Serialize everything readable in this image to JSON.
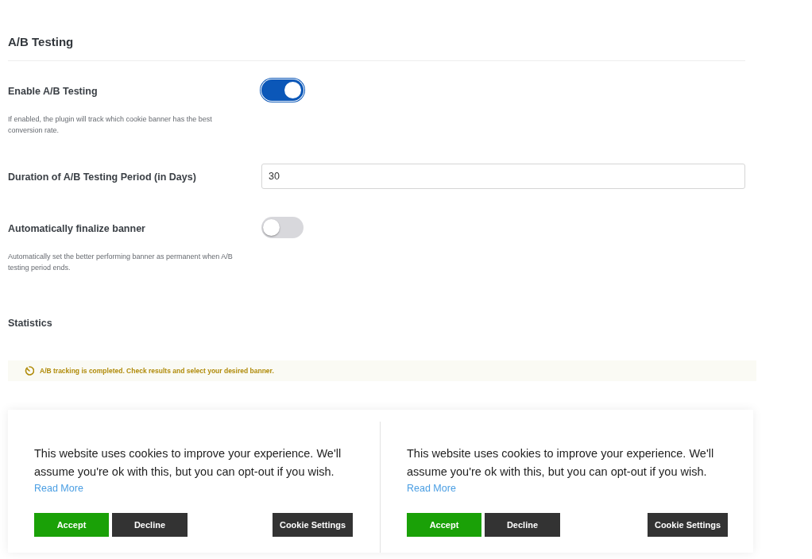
{
  "section": {
    "title": "A/B Testing"
  },
  "settings": [
    {
      "kind": "toggle",
      "label": "Enable A/B Testing",
      "on": true,
      "description": "If enabled, the plugin will track which cookie banner has the best conversion rate."
    },
    {
      "kind": "number",
      "label": "Duration of A/B Testing Period (in Days)",
      "value": "30"
    },
    {
      "kind": "toggle",
      "label": "Automatically finalize banner",
      "on": false,
      "description": "Automatically set the better performing banner as permanent when A/B testing period ends."
    }
  ],
  "statistics": {
    "title": "Statistics",
    "notice": "A/B tracking is completed. Check results and select your desired banner."
  },
  "banners": [
    {
      "message": "This website uses cookies to improve your experience. We'll assume you're ok with this, but you can opt-out if you wish.",
      "link": "Read More",
      "buttons": [
        {
          "kind": "accept",
          "label": "Accept"
        },
        {
          "kind": "decline",
          "label": "Decline"
        },
        {
          "kind": "settings",
          "label": "Cookie Settings"
        }
      ]
    },
    {
      "message": "This website uses cookies to improve your experience. We'll assume you're ok with this, but you can opt-out if you wish.",
      "link": "Read More",
      "buttons": [
        {
          "kind": "accept",
          "label": "Accept"
        },
        {
          "kind": "decline",
          "label": "Decline"
        },
        {
          "kind": "settings",
          "label": "Cookie Settings"
        }
      ]
    }
  ]
}
